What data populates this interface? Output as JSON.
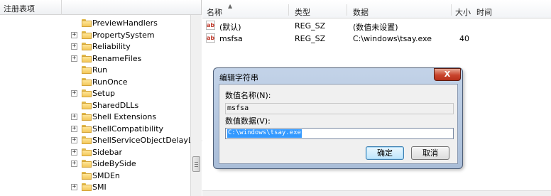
{
  "tree": {
    "header_title": "注册表项",
    "items": [
      {
        "label": "PreviewHandlers",
        "expandable": false
      },
      {
        "label": "PropertySystem",
        "expandable": true
      },
      {
        "label": "Reliability",
        "expandable": true
      },
      {
        "label": "RenameFiles",
        "expandable": true
      },
      {
        "label": "Run",
        "expandable": false
      },
      {
        "label": "RunOnce",
        "expandable": false
      },
      {
        "label": "Setup",
        "expandable": true
      },
      {
        "label": "SharedDLLs",
        "expandable": false
      },
      {
        "label": "Shell Extensions",
        "expandable": true
      },
      {
        "label": "ShellCompatibility",
        "expandable": true
      },
      {
        "label": "ShellServiceObjectDelayLoad",
        "expandable": true
      },
      {
        "label": "Sidebar",
        "expandable": true
      },
      {
        "label": "SideBySide",
        "expandable": true
      },
      {
        "label": "SMDEn",
        "expandable": false
      },
      {
        "label": "SMI",
        "expandable": true
      }
    ],
    "expander_symbol": "+"
  },
  "values": {
    "columns": {
      "name": "名称",
      "type": "类型",
      "data": "数据",
      "size": "大小",
      "time": "时间"
    },
    "sort_arrow": "▲",
    "rows": [
      {
        "icon": "string-value-icon",
        "name": "(默认)",
        "type": "REG_SZ",
        "data": "(数值未设置)",
        "size": ""
      },
      {
        "icon": "string-value-icon",
        "name": "msfsa",
        "type": "REG_SZ",
        "data": "C:\\windows\\tsay.exe",
        "size": "40"
      }
    ],
    "icon_text": "ab"
  },
  "dialog": {
    "title": "编辑字符串",
    "close_label": "X",
    "name_label": "数值名称(N):",
    "name_value": "msfsa",
    "data_label": "数值数据(V):",
    "data_value": "C:\\windows\\tsay.exe",
    "ok_label": "确定",
    "cancel_label": "取消"
  },
  "colors": {
    "selection": "#3399ff",
    "close_button": "#c9442d",
    "dialog_frame": "#a9bdd8"
  }
}
